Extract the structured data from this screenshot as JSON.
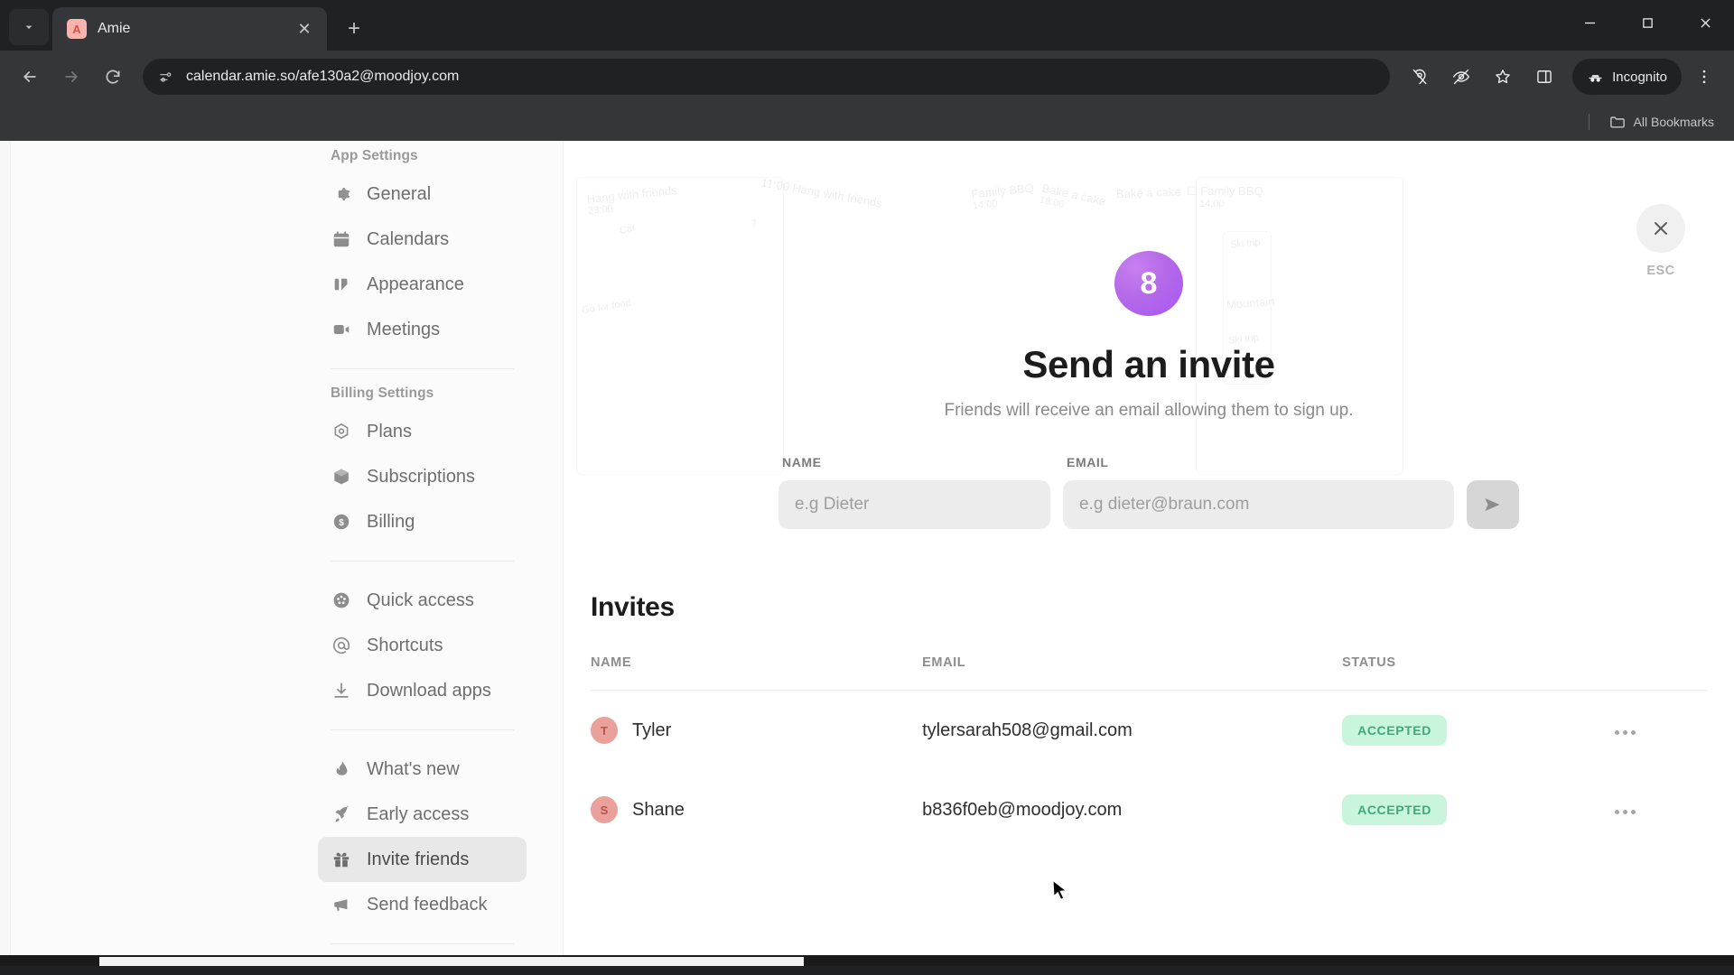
{
  "browser": {
    "tab": {
      "title": "Amie",
      "favicon_letter": "A",
      "favicon_color": "#f7b3ac"
    },
    "new_tab_label": "+",
    "omnibox": {
      "url": "calendar.amie.so/afe130a2@moodjoy.com",
      "icon": "page-settings-icon"
    },
    "toolbar_icons": [
      "location-blocked-icon",
      "eye-off-icon",
      "bookmark-star-icon",
      "side-panel-icon"
    ],
    "incognito_label": "Incognito",
    "menu_icon": "three-dot-menu-icon",
    "bookmarks": {
      "all_bookmarks_label": "All Bookmarks"
    },
    "window_controls": [
      "minimize",
      "maximize",
      "close"
    ]
  },
  "sidebar": {
    "groups": [
      {
        "label": "App Settings",
        "items": [
          {
            "label": "General",
            "icon": "gear-icon",
            "active": false
          },
          {
            "label": "Calendars",
            "icon": "calendar-icon",
            "active": false
          },
          {
            "label": "Appearance",
            "icon": "appearance-icon",
            "active": false
          },
          {
            "label": "Meetings",
            "icon": "video-camera-icon",
            "active": false
          }
        ]
      },
      {
        "label": "Billing Settings",
        "items": [
          {
            "label": "Plans",
            "icon": "hexagon-icon",
            "active": false
          },
          {
            "label": "Subscriptions",
            "icon": "box-icon",
            "active": false
          },
          {
            "label": "Billing",
            "icon": "dollar-coin-icon",
            "active": false
          }
        ]
      },
      {
        "label": "",
        "items": [
          {
            "label": "Quick access",
            "icon": "grid-circle-icon",
            "active": false
          },
          {
            "label": "Shortcuts",
            "icon": "at-sign-icon",
            "active": false
          },
          {
            "label": "Download apps",
            "icon": "download-icon",
            "active": false
          }
        ]
      },
      {
        "label": "",
        "items": [
          {
            "label": "What's new",
            "icon": "flame-icon",
            "active": false
          },
          {
            "label": "Early access",
            "icon": "rocket-icon",
            "active": false
          },
          {
            "label": "Invite friends",
            "icon": "gift-icon",
            "active": true
          },
          {
            "label": "Send feedback",
            "icon": "megaphone-icon",
            "active": false
          }
        ]
      }
    ]
  },
  "hero": {
    "badge_count": "8",
    "badge_color": "#a855f7",
    "title": "Send an invite",
    "subtitle": "Friends will receive an email allowing them to sign up.",
    "ghost_events": [
      {
        "title": "Hang with friends",
        "time": "23:00"
      },
      {
        "title": "Hang with friends",
        "time": "11:00"
      },
      {
        "title": "Family BBQ",
        "time": "14:00"
      },
      {
        "title": "Bake a cake",
        "time": "18:00"
      },
      {
        "title": "Bake a cake",
        "time": ""
      },
      {
        "title": "Family BBQ",
        "time": "14:00"
      },
      {
        "title": "Mountain",
        "time": ""
      }
    ]
  },
  "form": {
    "name_label": "NAME",
    "name_placeholder": "e.g Dieter",
    "name_value": "",
    "email_label": "EMAIL",
    "email_placeholder": "e.g dieter@braun.com",
    "email_value": "",
    "send_icon": "send-arrow-icon"
  },
  "invites": {
    "title": "Invites",
    "columns": [
      "NAME",
      "EMAIL",
      "STATUS",
      ""
    ],
    "rows": [
      {
        "initial": "T",
        "name": "Tyler",
        "email": "tylersarah508@gmail.com",
        "status": "ACCEPTED",
        "status_color": "#3fa97a"
      },
      {
        "initial": "S",
        "name": "Shane",
        "email": "b836f0eb@moodjoy.com",
        "status": "ACCEPTED",
        "status_color": "#3fa97a"
      }
    ]
  },
  "close": {
    "icon": "close-x-icon",
    "label": "ESC"
  }
}
